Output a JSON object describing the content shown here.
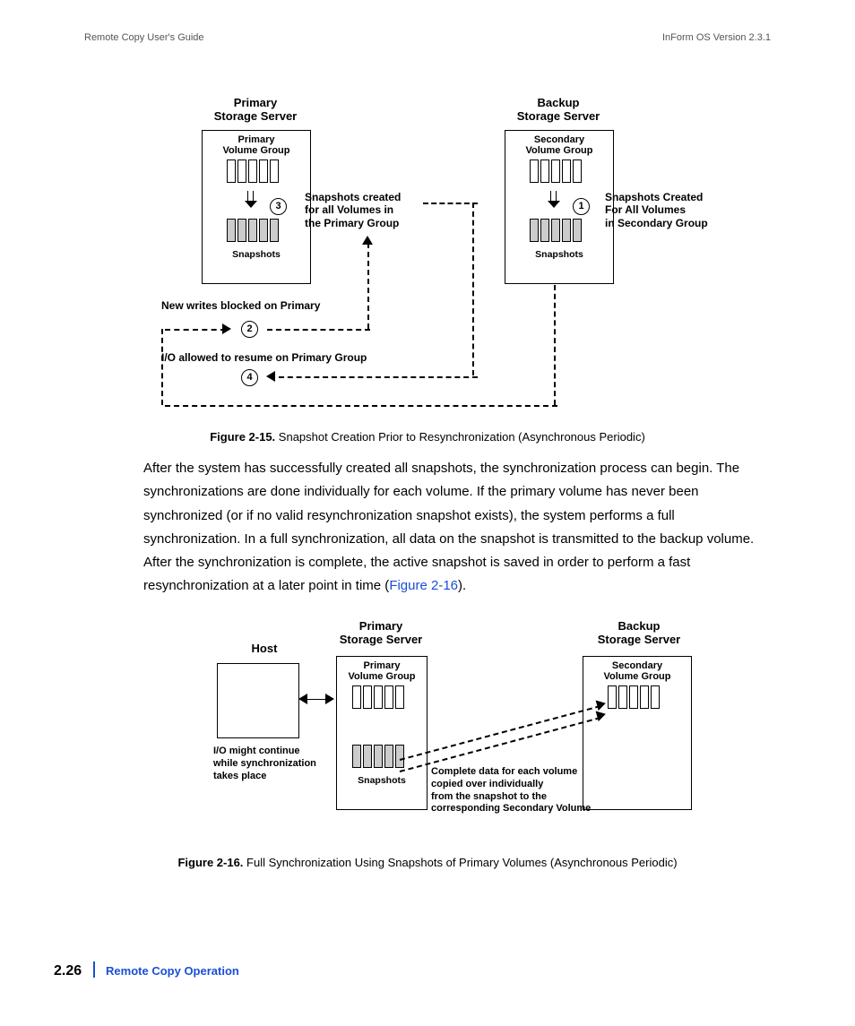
{
  "header": {
    "left": "Remote Copy User's Guide",
    "right": "InForm OS Version 2.3.1"
  },
  "fig15": {
    "primary_server": "Primary\nStorage Server",
    "backup_server": "Backup\nStorage Server",
    "primary_vg": "Primary\nVolume Group",
    "secondary_vg": "Secondary\nVolume Group",
    "snapshots": "Snapshots",
    "step3_text": "Snapshots created\nfor all Volumes in\nthe Primary Group",
    "step1_text": "Snapshots Created\nFor All Volumes\nin Secondary Group",
    "step2_text": "New writes blocked on Primary",
    "step4_text": "I/O allowed to resume on Primary Group",
    "n1": "1",
    "n2": "2",
    "n3": "3",
    "n4": "4",
    "caption_label": "Figure 2-15.",
    "caption_text": "Snapshot Creation Prior to Resynchronization (Asynchronous Periodic)"
  },
  "paragraph": {
    "text_before_link": "After the system has successfully created all snapshots, the synchronization process can begin. The synchronizations are done individually for each volume. If the primary volume has never been synchronized (or if no valid resynchronization snapshot exists), the system performs a full synchronization. In a full synchronization, all data on the snapshot is transmitted to the backup volume. After the synchronization is complete, the active snapshot is saved in order to perform a fast resynchronization at a later point in time (",
    "link": "Figure 2-16",
    "text_after_link": ")."
  },
  "fig16": {
    "host": "Host",
    "primary_server": "Primary\nStorage Server",
    "backup_server": "Backup\nStorage Server",
    "primary_vg": "Primary\nVolume Group",
    "secondary_vg": "Secondary\nVolume Group",
    "snapshots": "Snapshots",
    "io_caption": "I/O might continue\nwhile synchronization\ntakes place",
    "copy_caption": "Complete data for each volume\ncopied over individually\nfrom the snapshot to the\ncorresponding Secondary Volume",
    "caption_label": "Figure 2-16.",
    "caption_text": "Full Synchronization Using Snapshots of Primary Volumes (Asynchronous Periodic)"
  },
  "footer": {
    "page": "2.26",
    "section": "Remote Copy Operation"
  }
}
